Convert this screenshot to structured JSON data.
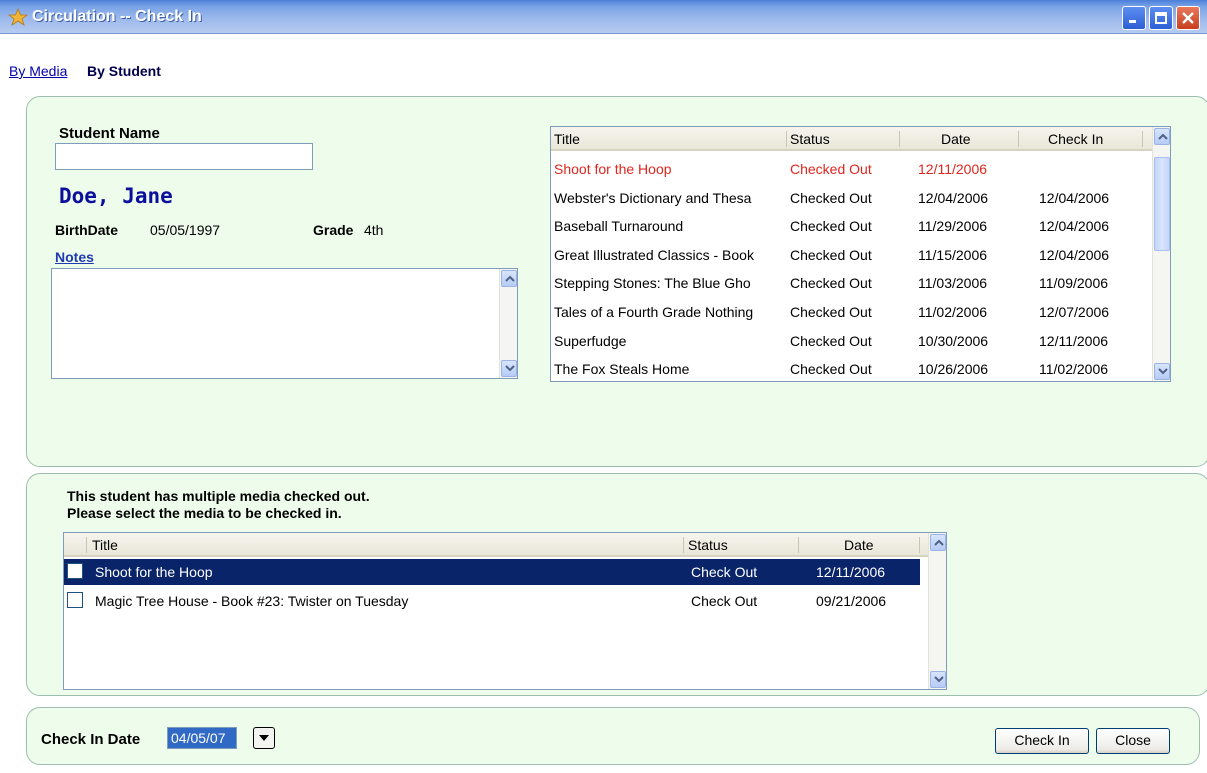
{
  "window": {
    "title": "Circulation -- Check In"
  },
  "tabs": {
    "by_media": "By Media",
    "by_student": "By Student"
  },
  "student": {
    "name_label": "Student Name",
    "name_input_value": "",
    "display_name": "Doe, Jane",
    "birthdate_label": "BirthDate",
    "birthdate_value": "05/05/1997",
    "grade_label": "Grade",
    "grade_value": "4th",
    "notes_label": "Notes",
    "notes_value": ""
  },
  "history": {
    "columns": [
      "Title",
      "Status",
      "Date",
      "Check In"
    ],
    "rows": [
      {
        "title": "Shoot for the Hoop",
        "status": "Checked Out",
        "date": "12/11/2006",
        "check_in": "",
        "alert": true
      },
      {
        "title": "Webster's Dictionary and Thesa",
        "status": "Checked Out",
        "date": "12/04/2006",
        "check_in": "12/04/2006"
      },
      {
        "title": "Baseball Turnaround",
        "status": "Checked Out",
        "date": "11/29/2006",
        "check_in": "12/04/2006"
      },
      {
        "title": "Great Illustrated Classics - Book",
        "status": "Checked Out",
        "date": "11/15/2006",
        "check_in": "12/04/2006"
      },
      {
        "title": "Stepping Stones: The Blue Gho",
        "status": "Checked Out",
        "date": "11/03/2006",
        "check_in": "11/09/2006"
      },
      {
        "title": "Tales of a Fourth Grade Nothing",
        "status": "Checked Out",
        "date": "11/02/2006",
        "check_in": "12/07/2006"
      },
      {
        "title": "Superfudge",
        "status": "Checked Out",
        "date": "10/30/2006",
        "check_in": "12/11/2006"
      },
      {
        "title": "The Fox Steals Home",
        "status": "Checked Out",
        "date": "10/26/2006",
        "check_in": "11/02/2006"
      }
    ],
    "alert_color": "#e0261f"
  },
  "selection": {
    "message_line1": "This student has multiple media checked out.",
    "message_line2": "Please select the media to be checked in.",
    "columns": [
      "Title",
      "Status",
      "Date"
    ],
    "rows": [
      {
        "title": "Shoot for the Hoop",
        "status": "Check Out",
        "date": "12/11/2006",
        "selected": true,
        "checked": false
      },
      {
        "title": "Magic Tree House - Book #23: Twister on Tuesday",
        "status": "Check Out",
        "date": "09/21/2006",
        "selected": false,
        "checked": false
      }
    ],
    "selected_color": "#0a246a"
  },
  "footer": {
    "check_in_date_label": "Check In Date",
    "check_in_date_value": "04/05/07",
    "check_in_button": "Check In",
    "close_button": "Close"
  },
  "colors": {
    "panel_bg": "#eefcec",
    "title_bar": "#7aa3e6",
    "name_color": "#0c0f9c"
  }
}
